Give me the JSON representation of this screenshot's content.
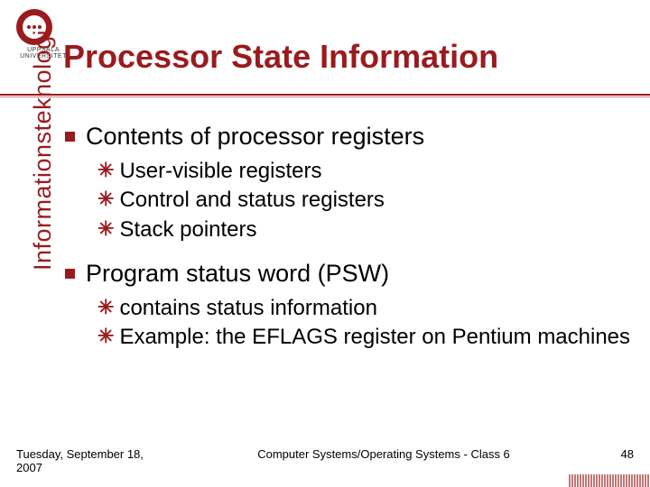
{
  "logo_label": "UPPSALA UNIVERSITET",
  "title": "Processor State Information",
  "sidebar": "Informationsteknologi",
  "bullets": [
    {
      "text": "Contents of processor registers",
      "sub": [
        "User-visible registers",
        "Control and status registers",
        "Stack pointers"
      ]
    },
    {
      "text": "Program status word (PSW)",
      "sub": [
        "contains status information",
        "Example: the EFLAGS register on Pentium machines"
      ]
    }
  ],
  "footer": {
    "date": "Tuesday, September 18, 2007",
    "mid": "Computer Systems/Operating Systems - Class 6",
    "page": "48"
  }
}
